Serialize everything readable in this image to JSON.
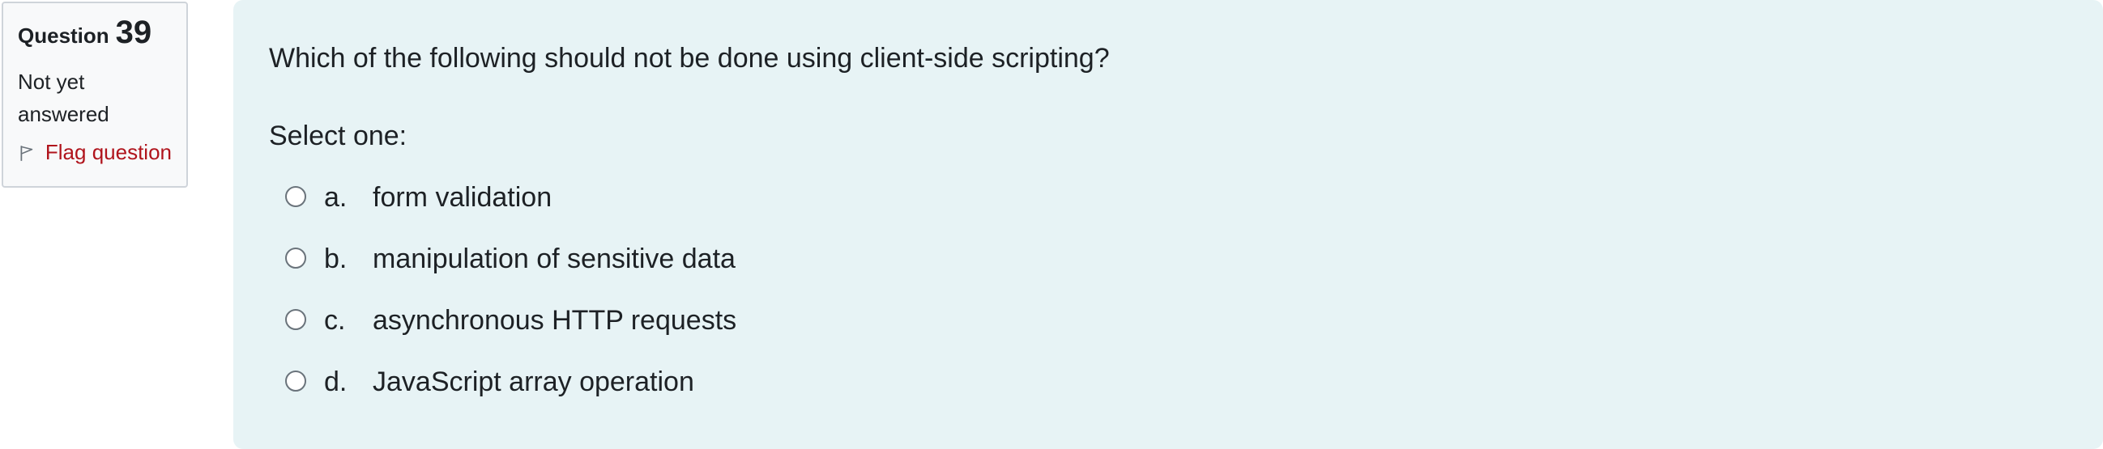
{
  "question": {
    "label": "Question",
    "number": "39",
    "state": "Not yet answered",
    "flag_label": "Flag question"
  },
  "content": {
    "question_text": "Which of the following should not be done using client-side scripting?",
    "prompt": "Select one:",
    "answers": [
      {
        "letter": "a.",
        "text": "form validation"
      },
      {
        "letter": "b.",
        "text": "manipulation of sensitive data"
      },
      {
        "letter": "c.",
        "text": "asynchronous HTTP requests"
      },
      {
        "letter": "d.",
        "text": "JavaScript array operation"
      }
    ]
  },
  "icons": {
    "flag": "flag-icon",
    "radio": "radio-icon"
  },
  "colors": {
    "flag_text": "#b0141c",
    "question_bg": "#e7f3f5",
    "info_bg": "#f8f9fa"
  }
}
